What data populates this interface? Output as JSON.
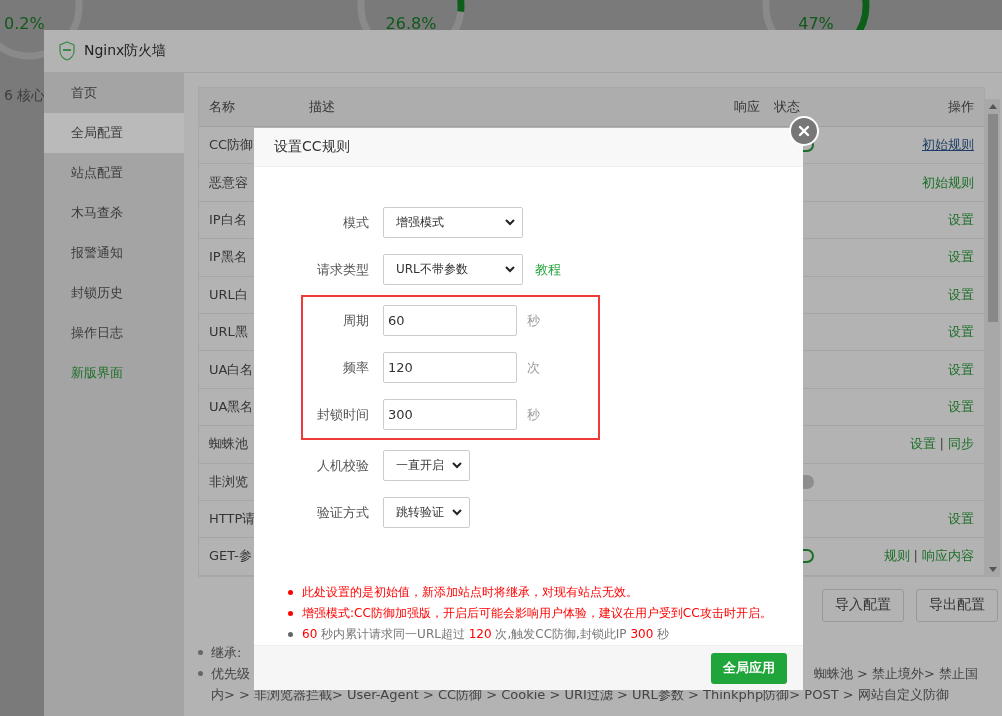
{
  "background": {
    "gauges": [
      {
        "value": "0.2%"
      },
      {
        "value": "26.8%"
      },
      {
        "value": "47%"
      }
    ],
    "core_label": "6 核心"
  },
  "window": {
    "title": "Nginx防火墙"
  },
  "sidebar": {
    "items": [
      {
        "label": "首页",
        "selected": false,
        "kind": "plain"
      },
      {
        "label": "全局配置",
        "selected": true,
        "kind": "plain"
      },
      {
        "label": "站点配置",
        "selected": false,
        "kind": "plain"
      },
      {
        "label": "木马查杀",
        "selected": false,
        "kind": "plain"
      },
      {
        "label": "报警通知",
        "selected": false,
        "kind": "plain"
      },
      {
        "label": "封锁历史",
        "selected": false,
        "kind": "plain"
      },
      {
        "label": "操作日志",
        "selected": false,
        "kind": "plain"
      },
      {
        "label": "新版界面",
        "selected": false,
        "kind": "link"
      }
    ]
  },
  "table": {
    "columns": [
      "名称",
      "描述",
      "响应",
      "状态",
      "操作"
    ],
    "rows": [
      {
        "name": "CC防御",
        "toggle_on": true,
        "actions": [
          {
            "label": "初始规则",
            "kind": "hover"
          }
        ]
      },
      {
        "name": "恶意容",
        "actions": [
          {
            "label": "初始规则",
            "kind": "link"
          }
        ]
      },
      {
        "name": "IP白名",
        "actions": [
          {
            "label": "设置",
            "kind": "link"
          }
        ]
      },
      {
        "name": "IP黑名",
        "actions": [
          {
            "label": "设置",
            "kind": "link"
          }
        ]
      },
      {
        "name": "URL白",
        "actions": [
          {
            "label": "设置",
            "kind": "link"
          }
        ]
      },
      {
        "name": "URL黑",
        "actions": [
          {
            "label": "设置",
            "kind": "link"
          }
        ]
      },
      {
        "name": "UA白名",
        "actions": [
          {
            "label": "设置",
            "kind": "link"
          }
        ]
      },
      {
        "name": "UA黑名",
        "actions": [
          {
            "label": "设置",
            "kind": "link"
          }
        ]
      },
      {
        "name": "蜘蛛池",
        "separator": "|",
        "actions": [
          {
            "label": "设置",
            "kind": "link"
          },
          {
            "label": "同步",
            "kind": "link"
          }
        ]
      },
      {
        "name": "非浏览",
        "toggle_on": false,
        "actions": []
      },
      {
        "name": "HTTP请",
        "actions": [
          {
            "label": "设置",
            "kind": "link"
          }
        ]
      },
      {
        "name": "GET-参",
        "toggle_on": true,
        "separator": "|",
        "actions": [
          {
            "label": "规则",
            "kind": "link"
          },
          {
            "label": "响应内容",
            "kind": "link"
          }
        ]
      }
    ]
  },
  "buttons": [
    "导入配置",
    "导出配置"
  ],
  "notes": [
    {
      "left": "继承:"
    },
    {
      "left": "优先级",
      "right": "蜘蛛池 > 禁止境外> 禁止国",
      "continuation": "内> > 非浏览器拦截> User-Agent > CC防御 > Cookie > URI过滤 > URL参数 > Thinkphp防御> POST > 网站自定义防御"
    }
  ],
  "modal": {
    "title": "设置CC规则",
    "fields": [
      {
        "label": "模式",
        "kind": "select",
        "value": "增强模式",
        "highlighted": false
      },
      {
        "label": "请求类型",
        "kind": "select",
        "value": "URL不带参数",
        "link": "教程",
        "highlighted": false
      },
      {
        "label": "周期",
        "kind": "input",
        "value": "60",
        "unit": "秒",
        "highlighted": true
      },
      {
        "label": "频率",
        "kind": "input",
        "value": "120",
        "unit": "次",
        "highlighted": true
      },
      {
        "label": "封锁时间",
        "kind": "input",
        "value": "300",
        "unit": "秒",
        "highlighted": true
      },
      {
        "label": "人机校验",
        "kind": "select",
        "value": "一直开启",
        "highlighted": false
      },
      {
        "label": "验证方式",
        "kind": "select",
        "value": "跳转验证",
        "highlighted": false
      }
    ],
    "notes": [
      {
        "kind": "warning",
        "text": "此处设置的是初始值，新添加站点时将继承，对现有站点无效。"
      },
      {
        "kind": "warning",
        "text": "增强模式:CC防御加强版，开启后可能会影响用户体验，建议在用户受到CC攻击时开启。"
      },
      {
        "kind": "info",
        "parts": [
          {
            "text": "60",
            "accent": true
          },
          {
            "text": " 秒内累计请求同一URL超过 ",
            "accent": false
          },
          {
            "text": "120",
            "accent": true
          },
          {
            "text": " 次,触发CC防御,封锁此IP ",
            "accent": false
          },
          {
            "text": "300",
            "accent": true
          },
          {
            "text": " 秒",
            "accent": false
          }
        ]
      }
    ],
    "submit": "全局应用"
  }
}
